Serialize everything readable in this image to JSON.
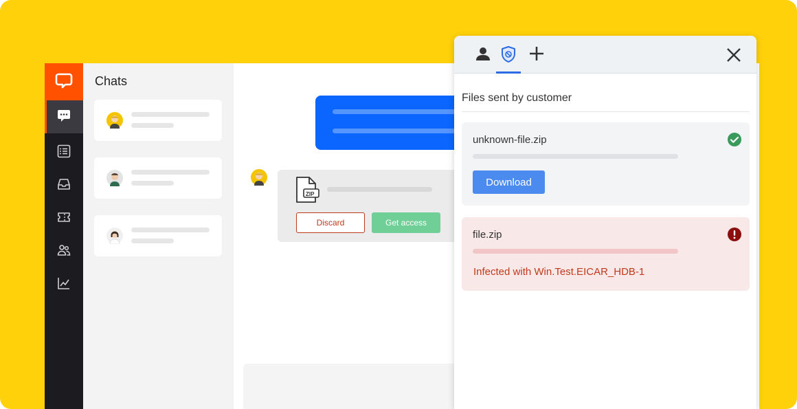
{
  "chats": {
    "title": "Chats"
  },
  "conversation": {
    "file_type_label": "ZIP",
    "discard_label": "Discard",
    "get_access_label": "Get access"
  },
  "panel": {
    "section_title": "Files sent by customer",
    "files": [
      {
        "name": "unknown-file.zip",
        "status": "clean",
        "action_label": "Download"
      },
      {
        "name": "file.zip",
        "status": "infected",
        "message": "Infected with Win.Test.EICAR_HDB-1"
      }
    ]
  },
  "colors": {
    "brand_orange": "#ff5100",
    "background_yellow": "#ffd10a",
    "accent_blue": "#0a66ff",
    "success_green": "#3a9a5c",
    "danger_red": "#c0391b"
  }
}
